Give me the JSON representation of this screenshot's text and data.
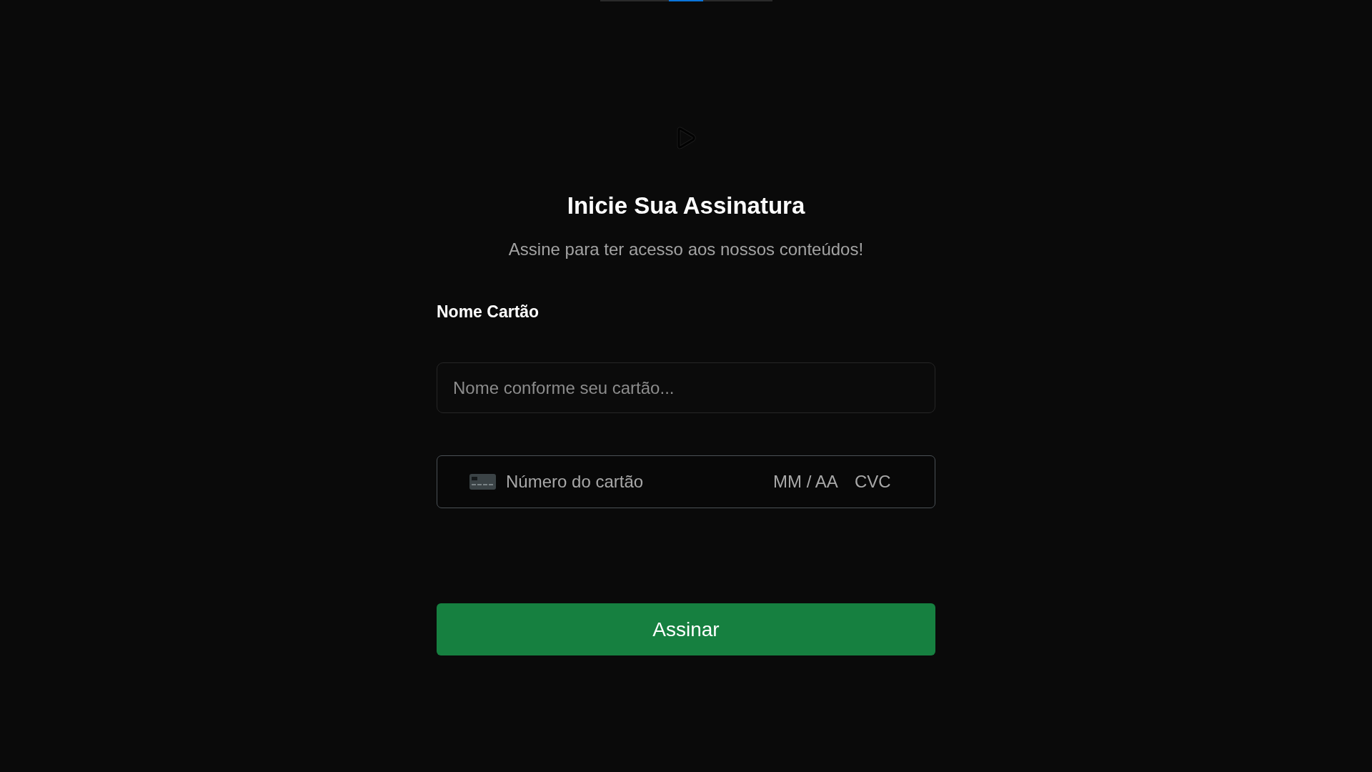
{
  "header": {
    "title": "Inicie Sua Assinatura",
    "subtitle": "Assine para ter acesso aos nossos conteúdos!"
  },
  "name_field": {
    "label": "Nome Cartão",
    "placeholder": "Nome conforme seu cartão..."
  },
  "card_field": {
    "number_placeholder": "Número do cartão",
    "expiry_placeholder": "MM / AA",
    "cvc_placeholder": "CVC"
  },
  "submit_button": {
    "label": "Assinar"
  }
}
